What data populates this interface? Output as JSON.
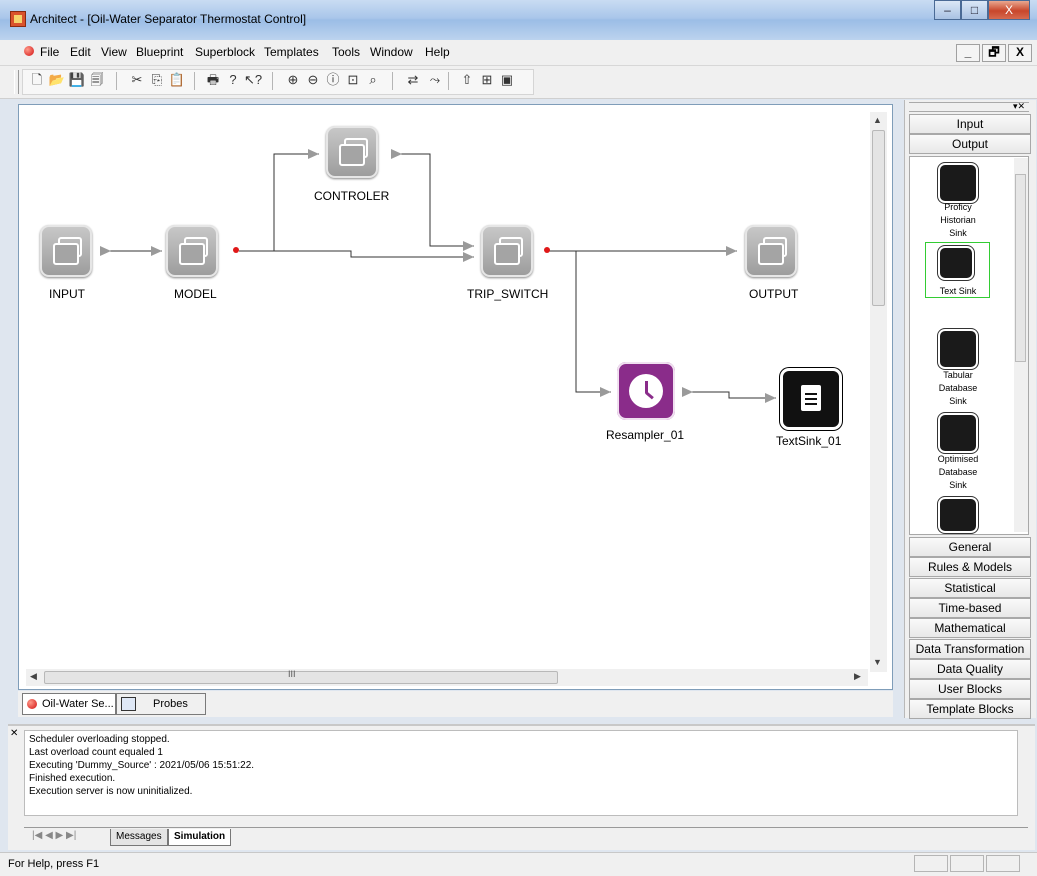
{
  "window": {
    "title": "Architect - [Oil-Water Separator Thermostat Control]",
    "min": "–",
    "max": "□",
    "close": "X"
  },
  "menu": {
    "items": [
      {
        "label": "File"
      },
      {
        "label": "Edit"
      },
      {
        "label": "View"
      },
      {
        "label": "Blueprint"
      },
      {
        "label": "Superblock"
      },
      {
        "label": "Templates"
      },
      {
        "label": "Tools"
      },
      {
        "label": "Window"
      },
      {
        "label": "Help"
      }
    ],
    "mdi_min": "_",
    "mdi_restore": "🗗",
    "mdi_close": "X"
  },
  "toolbar": {
    "icons": [
      "new-icon",
      "open-icon",
      "save-icon",
      "save-all-icon",
      "cut-icon",
      "copy-icon",
      "paste-icon",
      "print-icon",
      "help-icon",
      "context-help-icon",
      "zoom-in-icon",
      "zoom-out-icon",
      "zoom-actual-icon",
      "zoom-fit-icon",
      "find-icon",
      "connect-icon",
      "disconnect-icon",
      "upload-icon",
      "deploy-icon",
      "run-icon"
    ],
    "glyphs": [
      "🗋",
      "📂",
      "💾",
      "🗐",
      "✂",
      "⎘",
      "📋",
      "🖶",
      "?",
      "↖?",
      "⊕",
      "⊖",
      "ⓘ",
      "⊡",
      "⌕",
      "⇄",
      "⤳",
      "⇧",
      "⊞",
      "▣"
    ]
  },
  "blueprint": {
    "blocks": [
      {
        "id": "INPUT",
        "label": "INPUT"
      },
      {
        "id": "MODEL",
        "label": "MODEL"
      },
      {
        "id": "CONTROLER",
        "label": "CONTROLER"
      },
      {
        "id": "TRIP_SWITCH",
        "label": "TRIP_SWITCH"
      },
      {
        "id": "OUTPUT",
        "label": "OUTPUT"
      },
      {
        "id": "Resampler_01",
        "label": "Resampler_01"
      },
      {
        "id": "TextSink_01",
        "label": "TextSink_01"
      }
    ],
    "scroll_grip": "III"
  },
  "doc_tabs": [
    {
      "label": "Oil-Water Se..."
    },
    {
      "label": "Probes"
    }
  ],
  "palette": {
    "top_groups": [
      "Input",
      "Output"
    ],
    "items": [
      {
        "caption": "Proficy\nHistorian\nSink",
        "icon": "database-icon"
      },
      {
        "caption": "Text Sink",
        "icon": "document-icon",
        "selected": true
      },
      {
        "caption": "Tabular\nDatabase\nSink",
        "icon": "table-icon"
      },
      {
        "caption": "Optimised\nDatabase\nSink",
        "icon": "optimised-table-icon"
      }
    ],
    "bottom_groups": [
      "General",
      "Rules & Models",
      "Statistical",
      "Time-based",
      "Mathematical",
      "Data Transformation",
      "Data Quality",
      "User Blocks",
      "Template Blocks"
    ]
  },
  "output": {
    "lines": [
      "Scheduler overloading stopped.",
      "Last overload count equaled 1",
      "Executing 'Dummy_Source' : 2021/05/06 15:51:22.",
      "Finished execution.",
      "Execution server is now uninitialized."
    ],
    "tabs": [
      "Messages",
      "Simulation"
    ]
  },
  "status": {
    "text": "For Help, press F1"
  },
  "colors": {
    "resampler": "#8a2c8a",
    "selection": "#33cc33",
    "port_dot": "#e01818"
  }
}
